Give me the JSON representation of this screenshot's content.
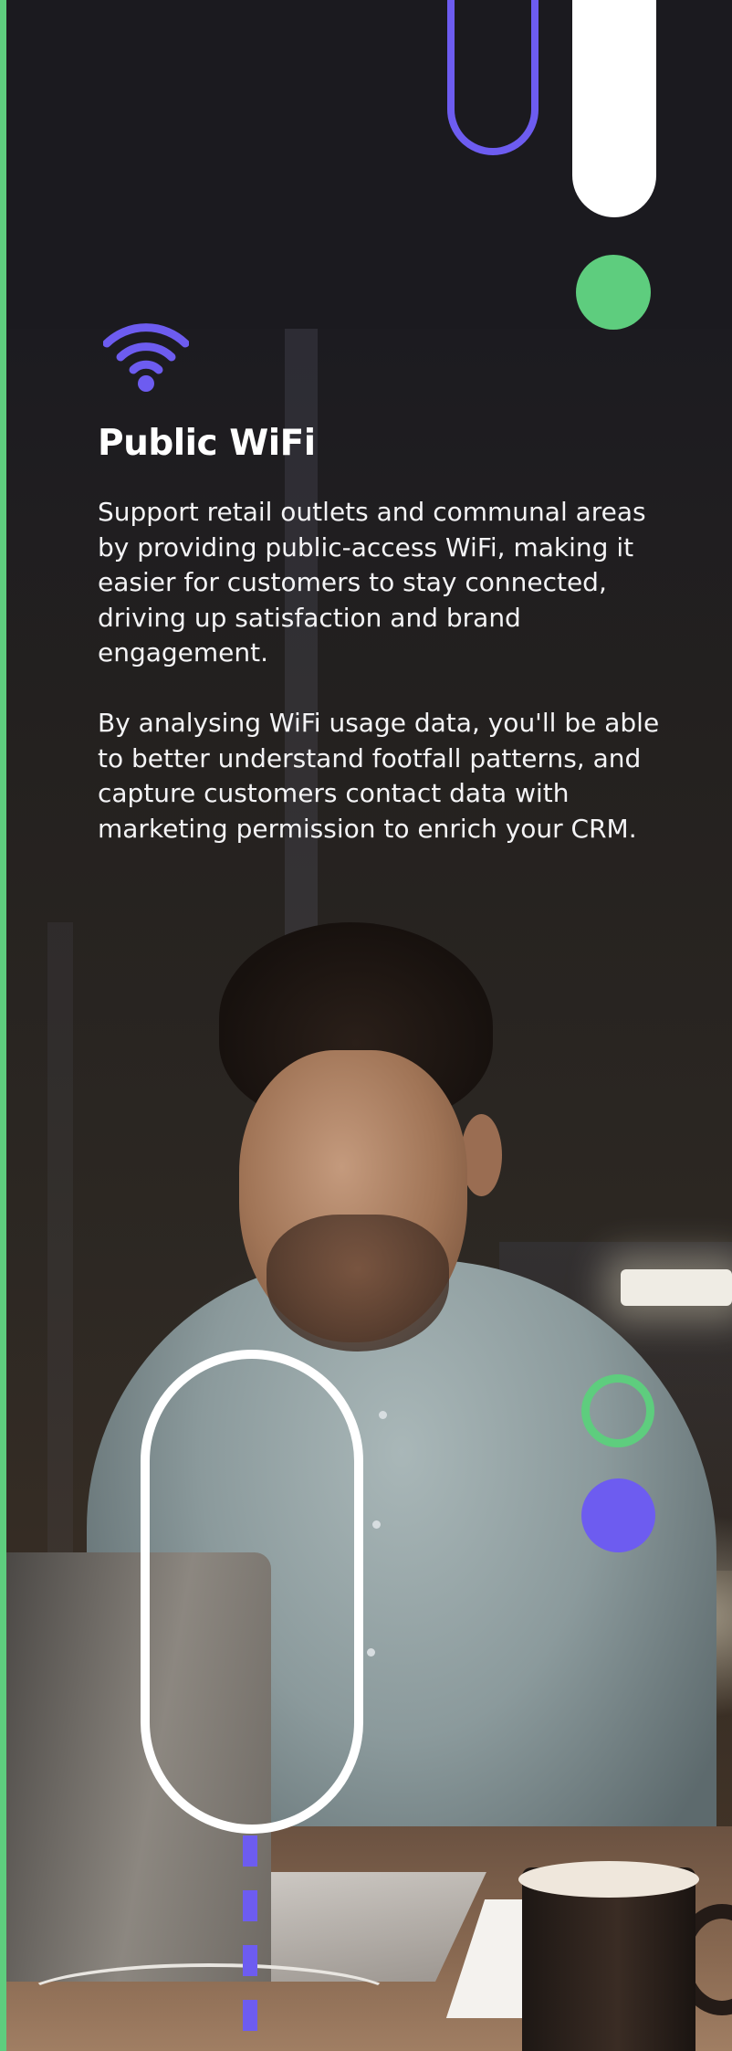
{
  "section": {
    "icon": "wifi-icon",
    "title": "Public WiFi",
    "paragraphs": [
      "Support retail outlets and communal areas by providing public-access WiFi, making it easier for customers to stay connected, driving up satisfaction and brand engagement.",
      "By analysing WiFi usage data, you'll be able to better understand footfall patterns, and capture customers contact data with marketing permission to enrich your CRM."
    ]
  },
  "colors": {
    "background": "#1b1a1f",
    "accent_green": "#5ecd7e",
    "accent_purple": "#6d5cf0",
    "text": "#ffffff"
  }
}
